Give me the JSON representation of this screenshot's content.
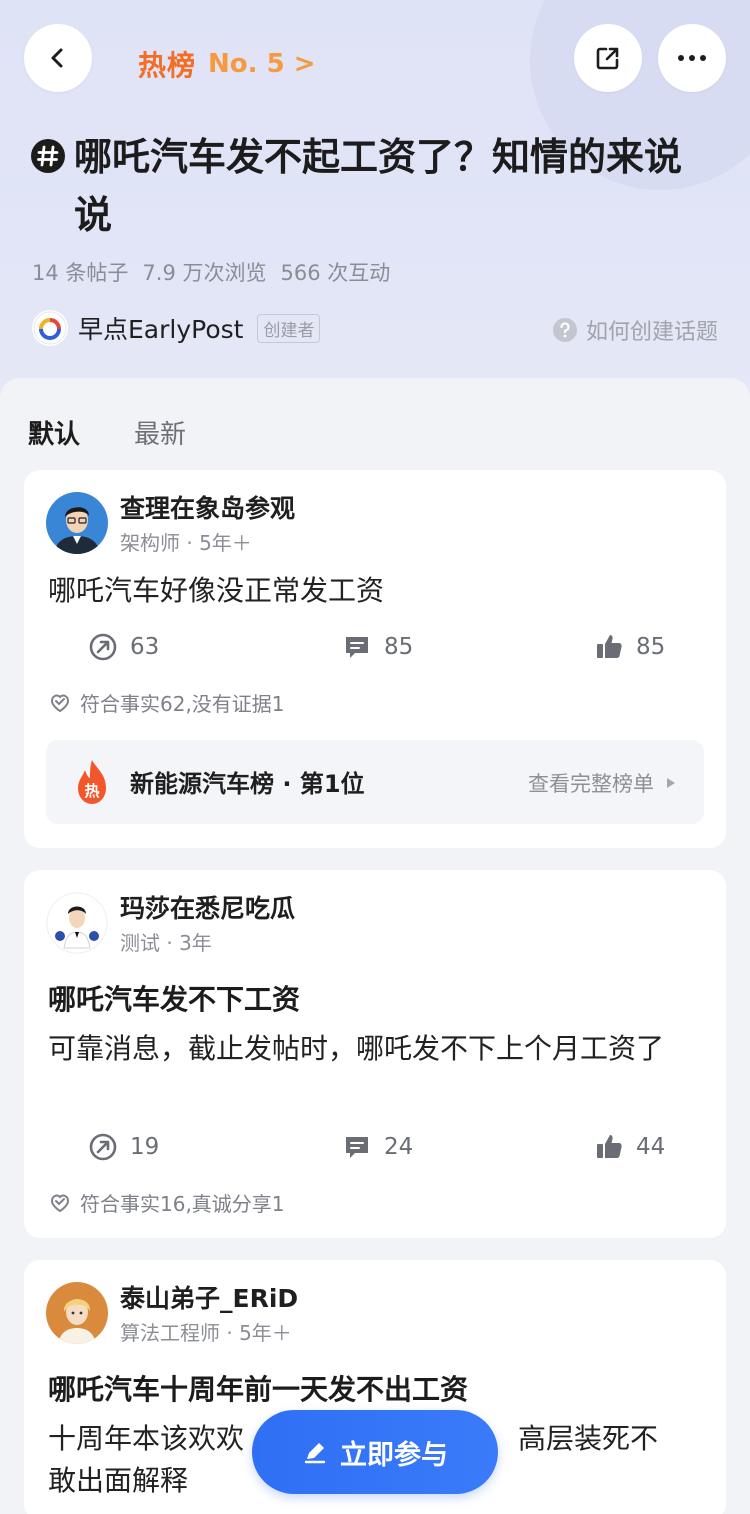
{
  "header": {
    "hot_label": "热榜",
    "rank_no": "No. 5 >",
    "title": "哪吒汽车发不起工资了？知情的来说说",
    "stats": {
      "posts": "14 条帖子",
      "views": "7.9 万次浏览",
      "interactions": "566 次互动"
    },
    "creator": {
      "name": "早点EarlyPost",
      "badge": "创建者"
    },
    "how_create": "如何创建话题"
  },
  "tabs": [
    {
      "label": "默认",
      "active": true
    },
    {
      "label": "最新",
      "active": false
    }
  ],
  "posts": [
    {
      "user": "查理在象岛参观",
      "meta": "架构师 · 5年＋",
      "title": "",
      "body": "哪吒汽车好像没正常发工资",
      "reposts": "63",
      "comments": "85",
      "likes": "85",
      "tags": "符合事实62,没有证据1",
      "rank_banner": {
        "label": "新能源汽车榜 · 第1位",
        "link": "查看完整榜单"
      }
    },
    {
      "user": "玛莎在悉尼吃瓜",
      "meta": "测试 · 3年",
      "title": "哪吒汽车发不下工资",
      "body": "可靠消息，截止发帖时，哪吒发不下上个月工资了",
      "reposts": "19",
      "comments": "24",
      "likes": "44",
      "tags": "符合事实16,真诚分享1"
    },
    {
      "user": "泰山弟子_ERiD",
      "meta": "算法工程师 · 5年＋",
      "title": "哪吒汽车十周年前一天发不出工资",
      "body_line1": "十周年本该欢欢",
      "body_line1_end": "高层装死不",
      "body_line2": "敢出面解释"
    }
  ],
  "fab": {
    "label": "立即参与"
  },
  "colors": {
    "accent": "#3170f5",
    "hot": "#f46d25",
    "header_bg": "#dfe3f6"
  }
}
